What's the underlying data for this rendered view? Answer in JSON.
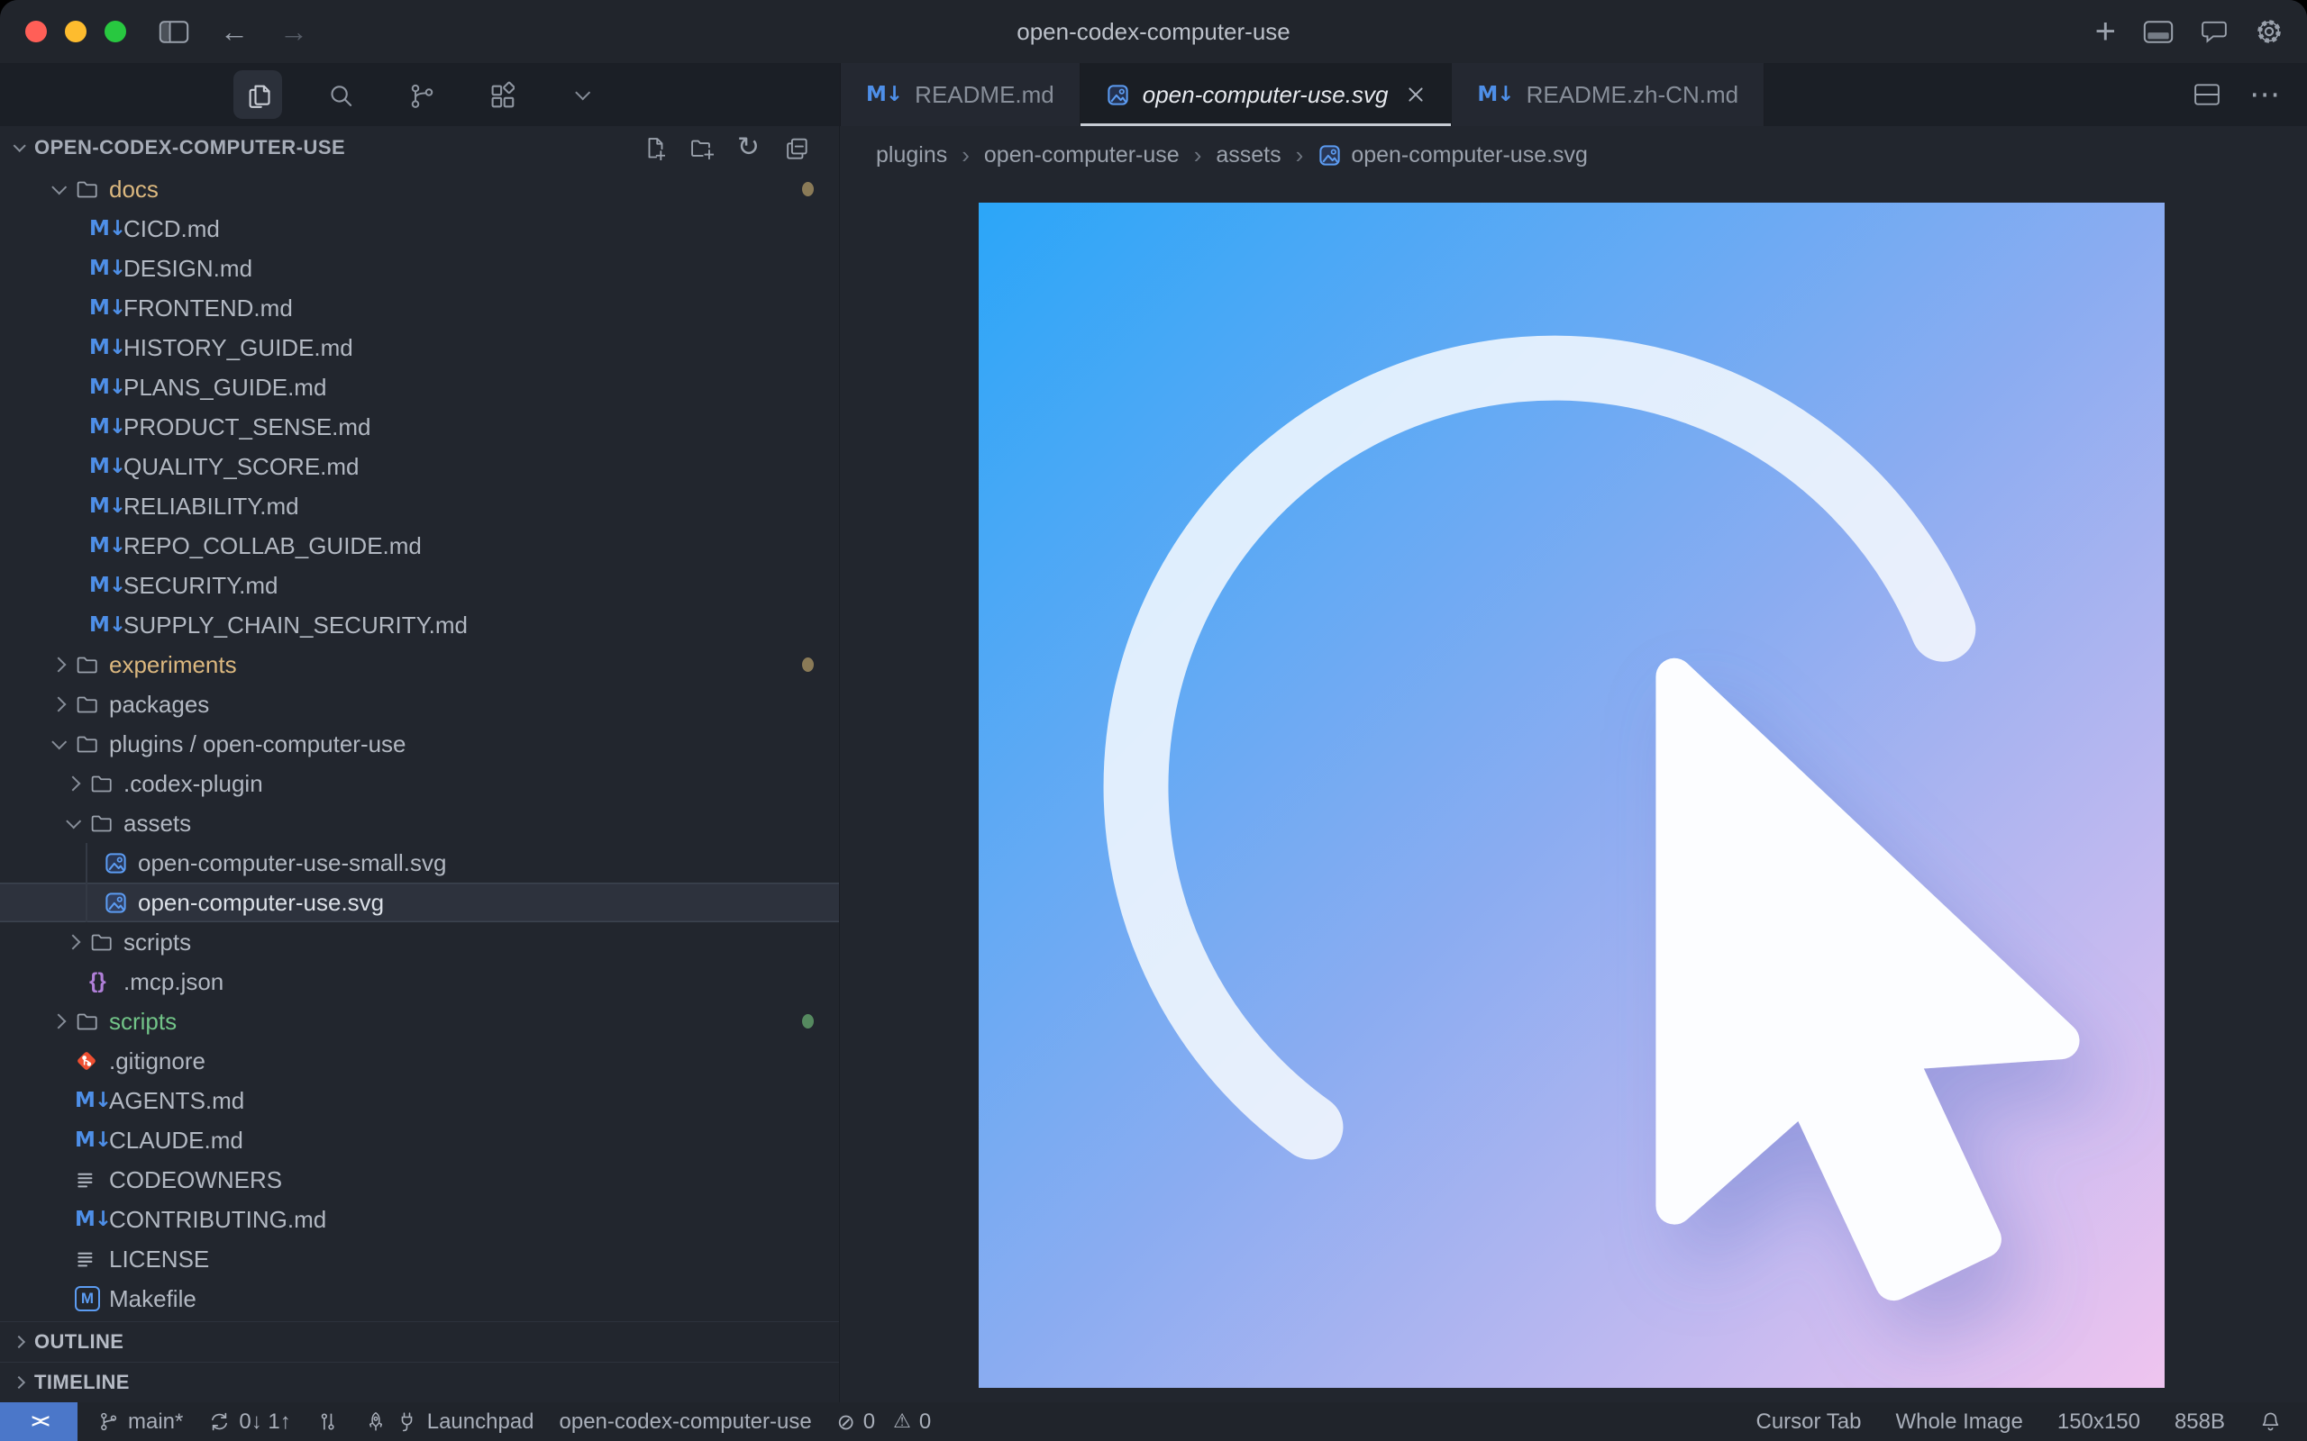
{
  "window": {
    "title": "open-codex-computer-use"
  },
  "activity_bar": {
    "icons": [
      {
        "name": "explorer",
        "active": true
      },
      {
        "name": "search",
        "active": false
      },
      {
        "name": "source-control",
        "active": false
      },
      {
        "name": "extensions",
        "active": false
      },
      {
        "name": "more-chevron",
        "active": false
      }
    ]
  },
  "sidebar": {
    "header": {
      "label": "OPEN-CODEX-COMPUTER-USE",
      "actions": [
        "new-file",
        "new-folder",
        "refresh",
        "collapse-all"
      ]
    },
    "tree": [
      {
        "label": "docs",
        "type": "folder",
        "level": 1,
        "chevron": "down",
        "color": "#dcb87f",
        "badge": "#8a7a57"
      },
      {
        "label": "CICD.md",
        "icon": "markdown",
        "level": 2
      },
      {
        "label": "DESIGN.md",
        "icon": "markdown",
        "level": 2
      },
      {
        "label": "FRONTEND.md",
        "icon": "markdown",
        "level": 2
      },
      {
        "label": "HISTORY_GUIDE.md",
        "icon": "markdown",
        "level": 2
      },
      {
        "label": "PLANS_GUIDE.md",
        "icon": "markdown",
        "level": 2
      },
      {
        "label": "PRODUCT_SENSE.md",
        "icon": "markdown",
        "level": 2
      },
      {
        "label": "QUALITY_SCORE.md",
        "icon": "markdown",
        "level": 2
      },
      {
        "label": "RELIABILITY.md",
        "icon": "markdown",
        "level": 2
      },
      {
        "label": "REPO_COLLAB_GUIDE.md",
        "icon": "markdown",
        "level": 2
      },
      {
        "label": "SECURITY.md",
        "icon": "markdown",
        "level": 2
      },
      {
        "label": "SUPPLY_CHAIN_SECURITY.md",
        "icon": "markdown",
        "level": 2
      },
      {
        "label": "experiments",
        "type": "folder",
        "level": 1,
        "chevron": "right",
        "color": "#dcb87f",
        "badge": "#8a7a57"
      },
      {
        "label": "packages",
        "type": "folder",
        "level": 1,
        "chevron": "right"
      },
      {
        "label": "plugins / open-computer-use",
        "type": "folder",
        "level": 1,
        "chevron": "down"
      },
      {
        "label": ".codex-plugin",
        "type": "folder",
        "level": 2,
        "chevron": "right"
      },
      {
        "label": "assets",
        "type": "folder",
        "level": 2,
        "chevron": "down"
      },
      {
        "label": "open-computer-use-small.svg",
        "icon": "image",
        "level": 3,
        "guide": true
      },
      {
        "label": "open-computer-use.svg",
        "icon": "image",
        "level": 3,
        "guide": true,
        "selected": true
      },
      {
        "label": "scripts",
        "type": "folder",
        "level": 2,
        "chevron": "right"
      },
      {
        "label": ".mcp.json",
        "icon": "braces",
        "level": 2
      },
      {
        "label": "scripts",
        "type": "folder",
        "level": 1,
        "chevron": "right",
        "color": "#72c488",
        "badge": "#55895f"
      },
      {
        "label": ".gitignore",
        "icon": "git",
        "level": 1
      },
      {
        "label": "AGENTS.md",
        "icon": "markdown",
        "level": 1
      },
      {
        "label": "CLAUDE.md",
        "icon": "markdown",
        "level": 1
      },
      {
        "label": "CODEOWNERS",
        "icon": "list",
        "level": 1
      },
      {
        "label": "CONTRIBUTING.md",
        "icon": "markdown",
        "level": 1
      },
      {
        "label": "LICENSE",
        "icon": "list",
        "level": 1
      },
      {
        "label": "Makefile",
        "icon": "mbox",
        "level": 1
      }
    ],
    "sections": [
      {
        "label": "OUTLINE"
      },
      {
        "label": "TIMELINE"
      }
    ]
  },
  "editor": {
    "tabs": [
      {
        "label": "README.md",
        "icon": "markdown",
        "active": false
      },
      {
        "label": "open-computer-use.svg",
        "icon": "image",
        "active": true,
        "close": true
      },
      {
        "label": "README.zh-CN.md",
        "icon": "markdown",
        "active": false
      }
    ],
    "breadcrumbs": [
      {
        "label": "plugins"
      },
      {
        "label": "open-computer-use"
      },
      {
        "label": "assets"
      },
      {
        "label": "open-computer-use.svg",
        "icon": "image"
      }
    ],
    "preview": {
      "gradient_start": "#2ba6f8",
      "gradient_mid": "#8aacf1",
      "gradient_end": "#efc4ef",
      "arc_color": "#f7fafe",
      "cursor_color": "#fcfdff"
    }
  },
  "statusbar": {
    "left": [
      {
        "name": "remote-indicator",
        "remote": true,
        "icons": [
          "remote"
        ],
        "text": ""
      },
      {
        "name": "git-branch",
        "icons": [
          "branch"
        ],
        "text": "main*"
      },
      {
        "name": "git-sync",
        "icons": [
          "sync"
        ],
        "text": "0↓ 1↑"
      },
      {
        "name": "scm-graph",
        "icons": [
          "graph"
        ],
        "text": ""
      },
      {
        "name": "launchpad",
        "icons": [
          "rocket",
          "plug"
        ],
        "text": "Launchpad"
      },
      {
        "name": "project-name",
        "icons": [],
        "text": "open-codex-computer-use"
      },
      {
        "name": "problems-errors",
        "icons": [
          "error"
        ],
        "text": "0"
      },
      {
        "name": "problems-warnings",
        "icons": [
          "warning"
        ],
        "text": "0",
        "tight": true
      }
    ],
    "right": [
      {
        "name": "cursor-tab",
        "icons": [],
        "text": "Cursor Tab"
      },
      {
        "name": "image-view-mode",
        "icons": [],
        "text": "Whole Image"
      },
      {
        "name": "image-dimensions",
        "icons": [],
        "text": "150x150"
      },
      {
        "name": "file-size",
        "icons": [],
        "text": "858B"
      },
      {
        "name": "notifications",
        "icons": [
          "bell"
        ],
        "text": ""
      }
    ]
  }
}
